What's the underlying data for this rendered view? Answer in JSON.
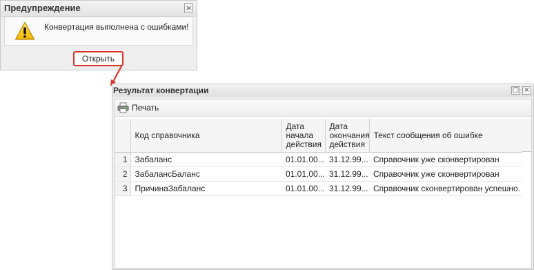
{
  "warning_dialog": {
    "title": "Предупреждение",
    "close_glyph": "×",
    "icon": "warning-triangle-icon",
    "message": "Конвертация выполнена с ошибками!",
    "open_button_label": "Открыть",
    "highlight_color": "#d9352c"
  },
  "result_window": {
    "title": "Результат конвертации",
    "maximize_glyph": "□",
    "close_glyph": "×",
    "toolbar": {
      "print_label": "Печать",
      "print_icon": "printer-icon"
    },
    "table": {
      "columns": [
        "",
        "Код справочника",
        "Дата начала действия",
        "Дата окончания действия",
        "Текст сообщения об ошибке"
      ],
      "rows": [
        {
          "num": "1",
          "code": "Забаланс",
          "start": "01.01.00...",
          "end": "31.12.99...",
          "message": "Справочник уже сконвертирован"
        },
        {
          "num": "2",
          "code": "ЗабалансБаланс",
          "start": "01.01.00...",
          "end": "31.12.99...",
          "message": "Справочник уже сконвертирован"
        },
        {
          "num": "3",
          "code": "ПричинаЗабаланс",
          "start": "01.01.00...",
          "end": "31.12.99...",
          "message": "Справочник сконвертирован успешно."
        }
      ]
    }
  }
}
